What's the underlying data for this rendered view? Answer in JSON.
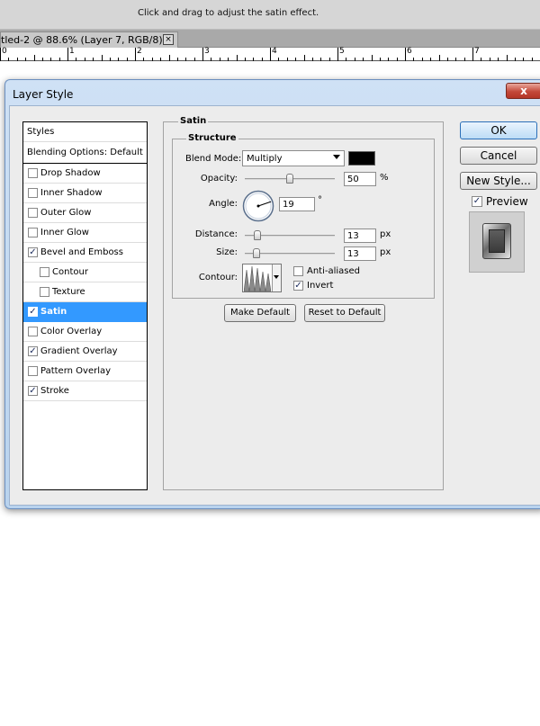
{
  "app": {
    "hint": "Click and drag to adjust the satin effect.",
    "doc_tab": "tled-2 @ 88.6% (Layer 7, RGB/8) *",
    "doc_tab_close": "×",
    "ruler_numbers": [
      "0",
      "1",
      "2",
      "3",
      "4",
      "5",
      "6",
      "7"
    ]
  },
  "dialog": {
    "title": "Layer Style",
    "close_glyph": "x",
    "styles_list": {
      "header": "Styles",
      "blending": "Blending Options: Default",
      "items": [
        {
          "label": "Drop Shadow",
          "checked": false,
          "indent": false,
          "selected": false
        },
        {
          "label": "Inner Shadow",
          "checked": false,
          "indent": false,
          "selected": false
        },
        {
          "label": "Outer Glow",
          "checked": false,
          "indent": false,
          "selected": false
        },
        {
          "label": "Inner Glow",
          "checked": false,
          "indent": false,
          "selected": false
        },
        {
          "label": "Bevel and Emboss",
          "checked": true,
          "indent": false,
          "selected": false
        },
        {
          "label": "Contour",
          "checked": false,
          "indent": true,
          "selected": false
        },
        {
          "label": "Texture",
          "checked": false,
          "indent": true,
          "selected": false
        },
        {
          "label": "Satin",
          "checked": true,
          "indent": false,
          "selected": true
        },
        {
          "label": "Color Overlay",
          "checked": false,
          "indent": false,
          "selected": false
        },
        {
          "label": "Gradient Overlay",
          "checked": true,
          "indent": false,
          "selected": false
        },
        {
          "label": "Pattern Overlay",
          "checked": false,
          "indent": false,
          "selected": false
        },
        {
          "label": "Stroke",
          "checked": true,
          "indent": false,
          "selected": false
        }
      ]
    },
    "satin": {
      "group_title": "Satin",
      "structure_title": "Structure",
      "blend_mode_label": "Blend Mode:",
      "blend_mode_value": "Multiply",
      "blend_color": "#000000",
      "opacity_label": "Opacity:",
      "opacity_value": "50",
      "opacity_unit": "%",
      "opacity_fraction": 0.5,
      "angle_label": "Angle:",
      "angle_value": "19",
      "angle_unit": "°",
      "distance_label": "Distance:",
      "distance_value": "13",
      "distance_unit": "px",
      "size_label": "Size:",
      "size_value": "13",
      "size_unit": "px",
      "contour_label": "Contour:",
      "anti_aliased_label": "Anti-aliased",
      "anti_aliased_checked": false,
      "invert_label": "Invert",
      "invert_checked": true
    },
    "buttons": {
      "make_default": "Make Default",
      "reset_default": "Reset to Default",
      "ok": "OK",
      "cancel": "Cancel",
      "new_style": "New Style..."
    },
    "preview": {
      "label": "Preview",
      "checked": true
    },
    "check_glyph": "✓"
  }
}
